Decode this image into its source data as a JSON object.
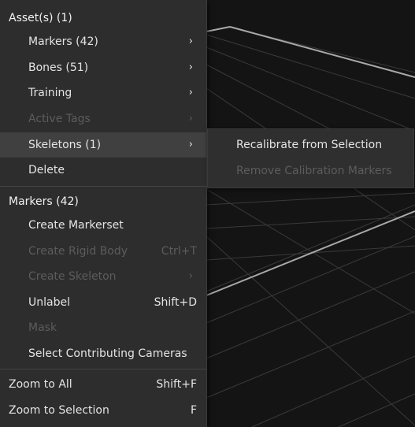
{
  "menu": {
    "sections": [
      {
        "header": "Asset(s) (1)",
        "items": [
          {
            "label": "Markers (42)",
            "arrow": "›"
          },
          {
            "label": "Bones (51)",
            "arrow": "›"
          },
          {
            "label": "Training",
            "arrow": "›"
          },
          {
            "label": "Active Tags",
            "arrow": "›"
          },
          {
            "label": "Skeletons (1)",
            "arrow": "›"
          },
          {
            "label": "Delete"
          }
        ]
      },
      {
        "header": "Markers (42)",
        "items": [
          {
            "label": "Create Markerset"
          },
          {
            "label": "Create Rigid Body",
            "shortcut": "Ctrl+T"
          },
          {
            "label": "Create Skeleton",
            "arrow": "›"
          },
          {
            "label": "Unlabel",
            "shortcut": "Shift+D"
          },
          {
            "label": "Mask"
          },
          {
            "label": "Select Contributing Cameras"
          }
        ]
      },
      {
        "items": [
          {
            "label": "Zoom to All",
            "shortcut": "Shift+F"
          },
          {
            "label": "Zoom to Selection",
            "shortcut": "F"
          }
        ]
      }
    ]
  },
  "submenu": {
    "items": [
      {
        "label": "Recalibrate from Selection"
      },
      {
        "label": "Remove Calibration Markers"
      }
    ]
  }
}
